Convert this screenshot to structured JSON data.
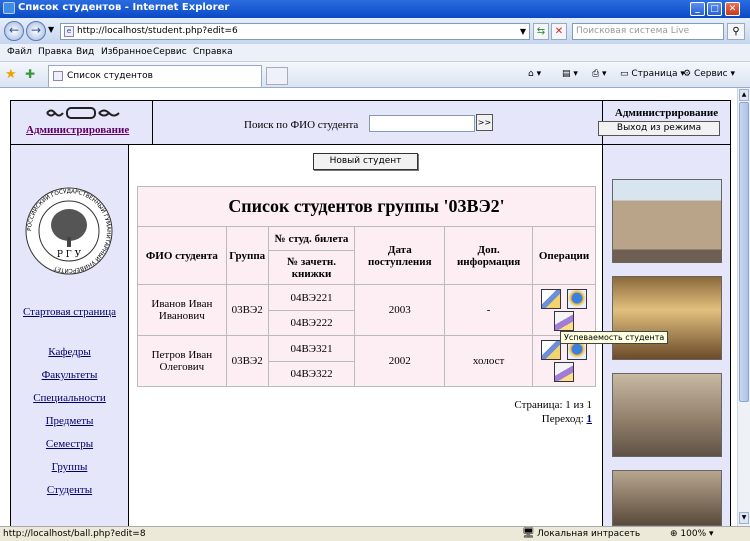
{
  "window": {
    "title": "Список студентов - Internet Explorer"
  },
  "address": {
    "url": "http://localhost/student.php?edit=6",
    "search_placeholder": "Поисковая система Live"
  },
  "menu": [
    "Файл",
    "Правка",
    "Вид",
    "Избранное",
    "Сервис",
    "Справка"
  ],
  "tab": {
    "label": "Список студентов"
  },
  "tools": {
    "page": "Страница",
    "service": "Сервис"
  },
  "header": {
    "admin_link": "Администрирование",
    "search_label": "Поиск по ФИО студента",
    "search_button": ">>",
    "admin_title": "Администрирование",
    "exit_button": "Выход из режима"
  },
  "sidebar": {
    "logo_text": "РОССИЙСКИЙ ГОСУДАРСТВЕННЫЙ ГУМАНИТАРНЫЙ УНИВЕРСИТЕТ",
    "logo_letters": "Р Г У",
    "home": "Стартовая страница",
    "items": [
      "Кафедры",
      "Факультеты",
      "Специальности",
      "Предметы",
      "Семестры",
      "Группы",
      "Студенты"
    ]
  },
  "main": {
    "new_student_button": "Новый студент",
    "table_title": "Список студентов группы '03ВЭ2'",
    "columns": {
      "name": "ФИО студента",
      "group": "Группа",
      "ticket": "№ студ. билета",
      "record_book": "№ зачетн. книжки",
      "year": "Дата поступления",
      "info": "Доп. информация",
      "ops": "Операции"
    },
    "rows": [
      {
        "name": "Иванов Иван Иванович",
        "group": "03ВЭ2",
        "ticket": "04ВЭ221",
        "record_book": "04ВЭ222",
        "year": "2003",
        "info": "-"
      },
      {
        "name": "Петров Иван Олегович",
        "group": "03ВЭ2",
        "ticket": "04ВЭ321",
        "record_book": "04ВЭ322",
        "year": "2002",
        "info": "холост"
      }
    ],
    "tooltip": "Успеваемость студента",
    "pager": {
      "page_text": "Страница: 1 из 1",
      "goto_label": "Переход:",
      "goto_page": "1"
    }
  },
  "status": {
    "url": "http://localhost/ball.php?edit=8",
    "zone": "Локальная интрасеть",
    "zoom": "100%"
  }
}
